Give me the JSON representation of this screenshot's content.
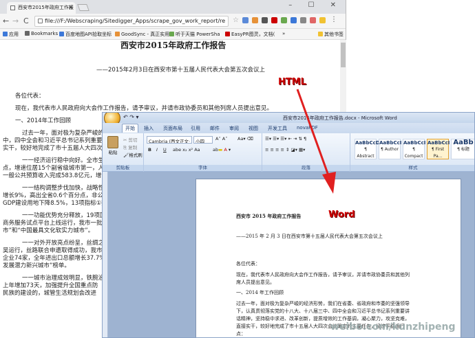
{
  "browser": {
    "tab_title": "西安市2015年政府工作报",
    "tab_close": "×",
    "window_controls": "– ☐ ✕",
    "nav_back": "←",
    "nav_forward": "→",
    "nav_reload": "C",
    "url": "file:///F:/Webscraping/Sitedigger_Apps/scrape_gov_work_report/re",
    "bookmarks": [
      {
        "label": "应用",
        "color": "#3c78d8"
      },
      {
        "label": "Bookmarks",
        "color": "#666666"
      },
      {
        "label": "百度地图API拾取坐标",
        "color": "#3c78d8"
      },
      {
        "label": "GoodSync - 真正实用",
        "color": "#e69138"
      },
      {
        "label": "听于天猫 PowerSha",
        "color": "#6aa84f"
      },
      {
        "label": "EasyPR图灵，文档(",
        "color": "#cc0000"
      }
    ],
    "bookmarks_more": "»",
    "other_bookmarks": "其他书签"
  },
  "html_doc": {
    "title": "西安市2015年政府工作报告",
    "subtitle": "——2015年2月3日在西安市第十五届人民代表大会第五次会议上",
    "salutation": "各位代表：",
    "intro": "现在，我代表市人民政府向大会作工作报告，请予审议，并请市政协委员和其他列席人员提出意见。",
    "section1": "一、2014年工作回顾",
    "paras": [
      "过去一年，面对极为复杂严峻的经",
      "中，四中全会和习近平总书记系列重要",
      "实干，较好地完成了市十五届人大四次",
      "一一经济运行稳中向好。全市生产",
      "点，增速位居15个副省级城市第一，人",
      "一般公共预算收入完成583.8亿元，增",
      "一一结构调整步伐加快，战略性新",
      "增长9%，高出全省0.6个百分点，非公",
      "GDP建设用地下降8.5%，13项指标①提前",
      "一一功能优势充分释放，19项国家",
      "商务服务试点平台上线运行，我市一批",
      "市”和“中国最具文化软实力城市”。",
      "一一对外开放亮点纷呈，丝绸之路",
      "吴运行，丝路联合申遗取得成功，我市",
      "企业74家，全年进出口总额增长37.7%",
      "发展潜力新兴城市”榜单。",
      "一一城市治理成效明显，铁腕治霾",
      "上年增加73天，加强提升全国重点防",
      "民族的建设的，城管生活规划会改进"
    ]
  },
  "word": {
    "qat": "↶ ↷ ▾",
    "title": "西安市2015年政府工作报告.docx - Microsoft Word",
    "tabs": [
      "开始",
      "插入",
      "页面布局",
      "引用",
      "邮件",
      "审阅",
      "视图",
      "开发工具",
      "novaPDF"
    ],
    "clipboard": {
      "paste": "粘贴",
      "cut": "剪切",
      "copy": "复制",
      "painter": "格式刷",
      "label": "剪贴板"
    },
    "font": {
      "name": "Cambria (西文正文·",
      "size": "小四",
      "label": "字体",
      "bold": "B",
      "italic": "I",
      "underline": "U"
    },
    "paragraph": {
      "label": "段落"
    },
    "styles": [
      {
        "preview": "AaBbCcDd",
        "name": "¶ Abstract"
      },
      {
        "preview": "AaBbCcI",
        "name": "¶ Author"
      },
      {
        "preview": "AaBbCcI",
        "name": "¶ Compact"
      },
      {
        "preview": "AaBbCcI",
        "name": "¶ First Pa..."
      },
      {
        "preview": "AaBb",
        "name": "¶ 标题"
      }
    ],
    "styles_label": "样式",
    "doc": {
      "title": "西安市 2015 年政府工作报告",
      "subtitle": "——2015 年 2 月 3 日在西安市第十五届人民代表大会第五次会议上",
      "salutation": "各位代表：",
      "intro1": "现在，我代表市人民政府向大会作工作报告，请予审议，并请市政协委员和其他列",
      "intro2": "席人员提出意见。",
      "section1": "一、2014 年工作回顾",
      "p1": "过去一年，面对极为复杂严峻的经济形势，我们在省委、省政府和市委的坚强领导",
      "p2": "下，认真贯彻落实党的十八大、十八届三中、四中全会和习近平总书记系列重要讲",
      "p3": "话精神，坚持稳中求进、改革创新，提质增效的工作基调，凝心聚力，攻坚克难，",
      "p4": "直接实干，较好地完成了市十五届人大四次会议确定的主要任务，经济平稳运行",
      "p5": "点："
    }
  },
  "annotations": {
    "html": "HTML",
    "word": "Word"
  },
  "watermark": "weibo.com/kunzhipeng",
  "colors": {
    "arrow": "#e02020",
    "word_blue": "#1b3a6b"
  }
}
